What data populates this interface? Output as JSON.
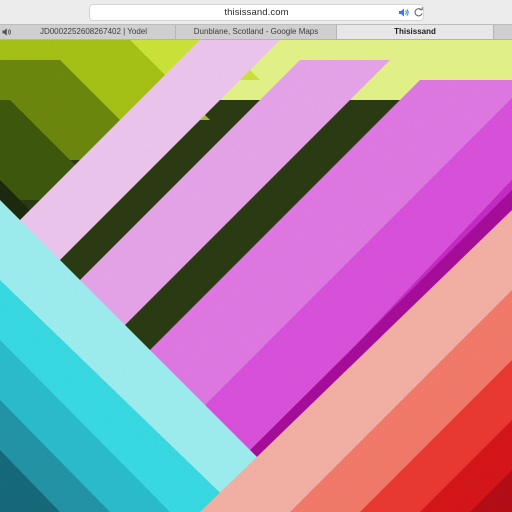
{
  "browser": {
    "address_bar": {
      "url": "thisissand.com"
    },
    "tabs": [
      {
        "label": "JD0002252608267402 | Yodel",
        "audio": true,
        "active": false
      },
      {
        "label": "Dunblane, Scotland - Google Maps",
        "active": false
      },
      {
        "label": "Thisissand",
        "active": true
      }
    ]
  },
  "artwork": {
    "description_colors": {
      "top_left_greens": [
        "#1f2a0b",
        "#3f5a10",
        "#6e8a12",
        "#a8c419",
        "#cfe63a",
        "#e6f58a"
      ],
      "magentas": [
        "#efc8ef",
        "#e9a6ec",
        "#e27ae6",
        "#dc52de",
        "#c82bc8",
        "#a8109c"
      ],
      "cyans": [
        "#9ff0f2",
        "#39dde6",
        "#2bbfcf",
        "#2196a8",
        "#186b7c"
      ],
      "reds": [
        "#f6b3a6",
        "#f57c6c",
        "#ee3a34",
        "#d8141a",
        "#b70f14"
      ]
    }
  }
}
